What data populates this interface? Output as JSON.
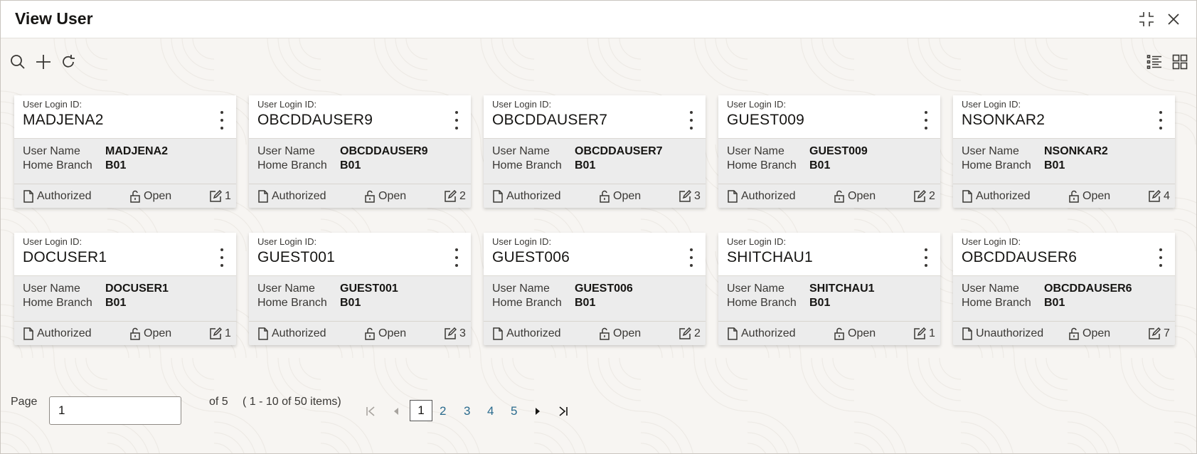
{
  "window": {
    "title": "View User"
  },
  "cards": [
    {
      "id_label": "User Login ID:",
      "login_id": "MADJENA2",
      "name_label": "User Name",
      "name": "MADJENA2",
      "branch_label": "Home Branch",
      "branch": "B01",
      "auth": "Authorized",
      "lock": "Open",
      "mods": "1"
    },
    {
      "id_label": "User Login ID:",
      "login_id": "OBCDDAUSER9",
      "name_label": "User Name",
      "name": "OBCDDAUSER9",
      "branch_label": "Home Branch",
      "branch": "B01",
      "auth": "Authorized",
      "lock": "Open",
      "mods": "2"
    },
    {
      "id_label": "User Login ID:",
      "login_id": "OBCDDAUSER7",
      "name_label": "User Name",
      "name": "OBCDDAUSER7",
      "branch_label": "Home Branch",
      "branch": "B01",
      "auth": "Authorized",
      "lock": "Open",
      "mods": "3"
    },
    {
      "id_label": "User Login ID:",
      "login_id": "GUEST009",
      "name_label": "User Name",
      "name": "GUEST009",
      "branch_label": "Home Branch",
      "branch": "B01",
      "auth": "Authorized",
      "lock": "Open",
      "mods": "2"
    },
    {
      "id_label": "User Login ID:",
      "login_id": "NSONKAR2",
      "name_label": "User Name",
      "name": "NSONKAR2",
      "branch_label": "Home Branch",
      "branch": "B01",
      "auth": "Authorized",
      "lock": "Open",
      "mods": "4"
    },
    {
      "id_label": "User Login ID:",
      "login_id": "DOCUSER1",
      "name_label": "User Name",
      "name": "DOCUSER1",
      "branch_label": "Home Branch",
      "branch": "B01",
      "auth": "Authorized",
      "lock": "Open",
      "mods": "1"
    },
    {
      "id_label": "User Login ID:",
      "login_id": "GUEST001",
      "name_label": "User Name",
      "name": "GUEST001",
      "branch_label": "Home Branch",
      "branch": "B01",
      "auth": "Authorized",
      "lock": "Open",
      "mods": "3"
    },
    {
      "id_label": "User Login ID:",
      "login_id": "GUEST006",
      "name_label": "User Name",
      "name": "GUEST006",
      "branch_label": "Home Branch",
      "branch": "B01",
      "auth": "Authorized",
      "lock": "Open",
      "mods": "2"
    },
    {
      "id_label": "User Login ID:",
      "login_id": "SHITCHAU1",
      "name_label": "User Name",
      "name": "SHITCHAU1",
      "branch_label": "Home Branch",
      "branch": "B01",
      "auth": "Authorized",
      "lock": "Open",
      "mods": "1"
    },
    {
      "id_label": "User Login ID:",
      "login_id": "OBCDDAUSER6",
      "name_label": "User Name",
      "name": "OBCDDAUSER6",
      "branch_label": "Home Branch",
      "branch": "B01",
      "auth": "Unauthorized",
      "lock": "Open",
      "mods": "7"
    }
  ],
  "pagination": {
    "page_label": "Page",
    "page_value": "1",
    "of_label": "of 5",
    "items_label": "( 1 - 10 of 50 items)",
    "pages": [
      "1",
      "2",
      "3",
      "4",
      "5"
    ]
  },
  "colors": {
    "link": "#2a6b8e",
    "text": "#161513",
    "muted": "#3a3835",
    "card_body": "#ececec"
  }
}
